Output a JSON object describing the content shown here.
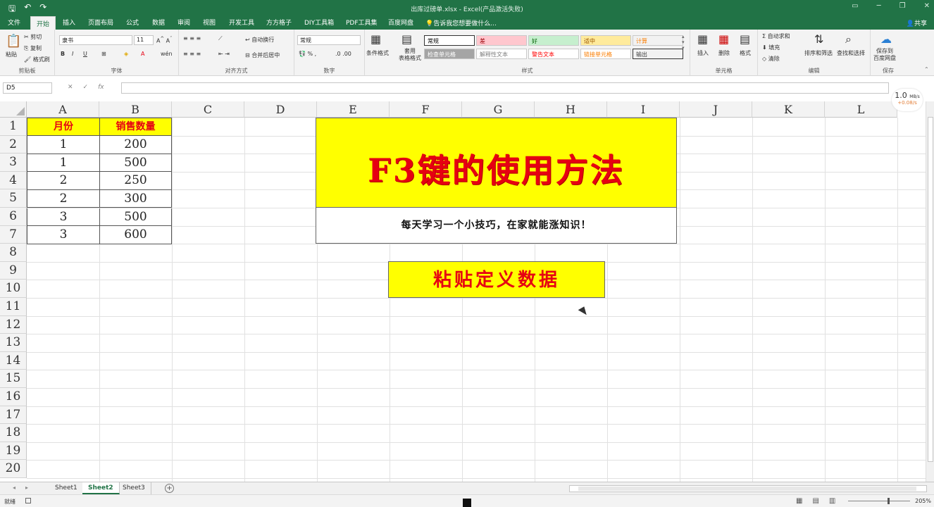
{
  "window": {
    "title": "出库过磅单.xlsx - Excel(产品激活失败)"
  },
  "tabs": [
    {
      "label": "文件"
    },
    {
      "label": "开始"
    },
    {
      "label": "插入"
    },
    {
      "label": "页面布局"
    },
    {
      "label": "公式"
    },
    {
      "label": "数据"
    },
    {
      "label": "审阅"
    },
    {
      "label": "视图"
    },
    {
      "label": "开发工具"
    },
    {
      "label": "方方格子"
    },
    {
      "label": "DIY工具箱"
    },
    {
      "label": "PDF工具集"
    },
    {
      "label": "百度网盘"
    }
  ],
  "tell_me": "告诉我您想要做什么...",
  "share": "共享",
  "ribbon": {
    "clipboard": {
      "paste": "粘贴",
      "cut": "剪切",
      "copy": "复制",
      "format_painter": "格式刷",
      "label": "剪贴板"
    },
    "font": {
      "name": "隶书",
      "size": "11",
      "label": "字体"
    },
    "align": {
      "wrap": "自动换行",
      "merge": "合并后居中",
      "label": "对齐方式"
    },
    "number": {
      "format": "常规",
      "label": "数字"
    },
    "styles": {
      "conditional": "条件格式",
      "table": "套用\n表格格式",
      "label": "样式",
      "cells": [
        {
          "text": "常规",
          "bg": "#ffffff",
          "color": "#000000"
        },
        {
          "text": "差",
          "bg": "#ffc7ce",
          "color": "#9c0006"
        },
        {
          "text": "好",
          "bg": "#c6efce",
          "color": "#006100"
        },
        {
          "text": "适中",
          "bg": "#ffeb9c",
          "color": "#9c5700"
        },
        {
          "text": "计算",
          "bg": "#f2f2f2",
          "color": "#fa7d00"
        },
        {
          "text": "检查单元格",
          "bg": "#a5a5a5",
          "color": "#ffffff"
        },
        {
          "text": "解释性文本",
          "bg": "#ffffff",
          "color": "#7f7f7f"
        },
        {
          "text": "警告文本",
          "bg": "#ffffff",
          "color": "#ff0000"
        },
        {
          "text": "链接单元格",
          "bg": "#ffffff",
          "color": "#fa7d00"
        },
        {
          "text": "输出",
          "bg": "#f2f2f2",
          "color": "#3f3f3f"
        }
      ]
    },
    "cells_grp": {
      "insert": "插入",
      "delete": "删除",
      "format": "格式",
      "label": "单元格"
    },
    "editing": {
      "autosum": "自动求和",
      "fill": "填充",
      "clear": "清除",
      "sort": "排序和筛选",
      "find": "查找和选择",
      "label": "编辑"
    },
    "save": {
      "baidu": "保存到\n百度网盘",
      "label": "保存"
    }
  },
  "formula_bar": {
    "name_box": "D5",
    "fx": "fx",
    "value": ""
  },
  "speed": {
    "value": "1.0",
    "unit": "MB/s",
    "sub": "+0.08/s"
  },
  "columns": [
    "A",
    "B",
    "C",
    "D",
    "E",
    "F",
    "G",
    "H",
    "I",
    "J",
    "K",
    "L"
  ],
  "rows": [
    "1",
    "2",
    "3",
    "4",
    "5",
    "6",
    "7",
    "8",
    "9",
    "10",
    "11",
    "12",
    "13",
    "14",
    "15",
    "16",
    "17",
    "18",
    "19",
    "20"
  ],
  "table": {
    "headers": [
      "月份",
      "销售数量"
    ],
    "rows": [
      [
        "1",
        "200"
      ],
      [
        "1",
        "500"
      ],
      [
        "2",
        "250"
      ],
      [
        "2",
        "300"
      ],
      [
        "3",
        "500"
      ],
      [
        "3",
        "600"
      ]
    ]
  },
  "banner": "F3键的使用方法",
  "subtitle": "每天学习一个小技巧，在家就能涨知识！",
  "paste_label": "粘贴定义数据",
  "sheets": [
    {
      "label": "Sheet1"
    },
    {
      "label": "Sheet2",
      "active": true
    },
    {
      "label": "Sheet3"
    }
  ],
  "status": {
    "ready": "就绪",
    "zoom": "205%"
  }
}
